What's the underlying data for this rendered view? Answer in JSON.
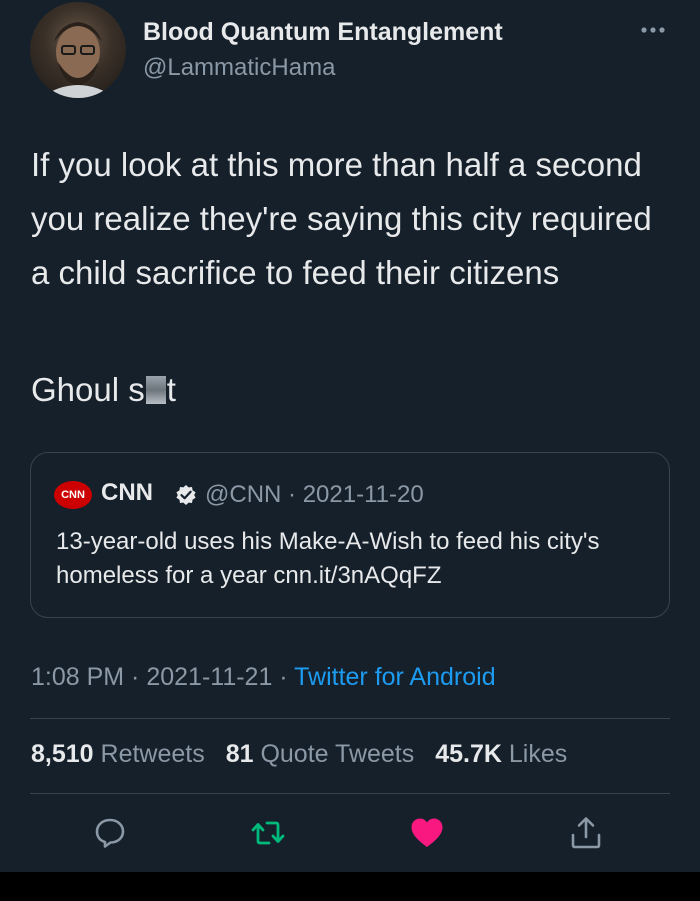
{
  "author": {
    "name": "Blood Quantum Entanglement",
    "handle": "@LammaticHama"
  },
  "tweet": {
    "text": "If you look at this more than half a second you realize they're saying this city required a child sacrifice to feed their citizens",
    "line2_start": "Ghoul s",
    "line2_end": "t"
  },
  "quoted": {
    "logo_text": "CNN",
    "name": "CNN",
    "meta": "@CNN · 2021-11-20",
    "text": "13-year-old uses his Make-A-Wish to feed his city's homeless for a year cnn.it/3nAQqFZ"
  },
  "meta": {
    "time": "1:08 PM",
    "date": "2021-11-21",
    "source": "Twitter for Android"
  },
  "stats": {
    "retweets_count": "8,510",
    "retweets_label": "Retweets",
    "quotes_count": "81",
    "quotes_label": "Quote Tweets",
    "likes_count": "45.7K",
    "likes_label": "Likes"
  },
  "colors": {
    "background": "#15202b",
    "accent": "#1d9bf0",
    "retweet": "#00ba7c",
    "like": "#f91880",
    "secondary_text": "#8b98a5"
  },
  "icons": {
    "more": "more-horizontal-icon",
    "verified": "verified-badge-icon",
    "reply": "reply-icon",
    "retweet": "retweet-icon",
    "like": "heart-icon",
    "share": "share-icon"
  }
}
